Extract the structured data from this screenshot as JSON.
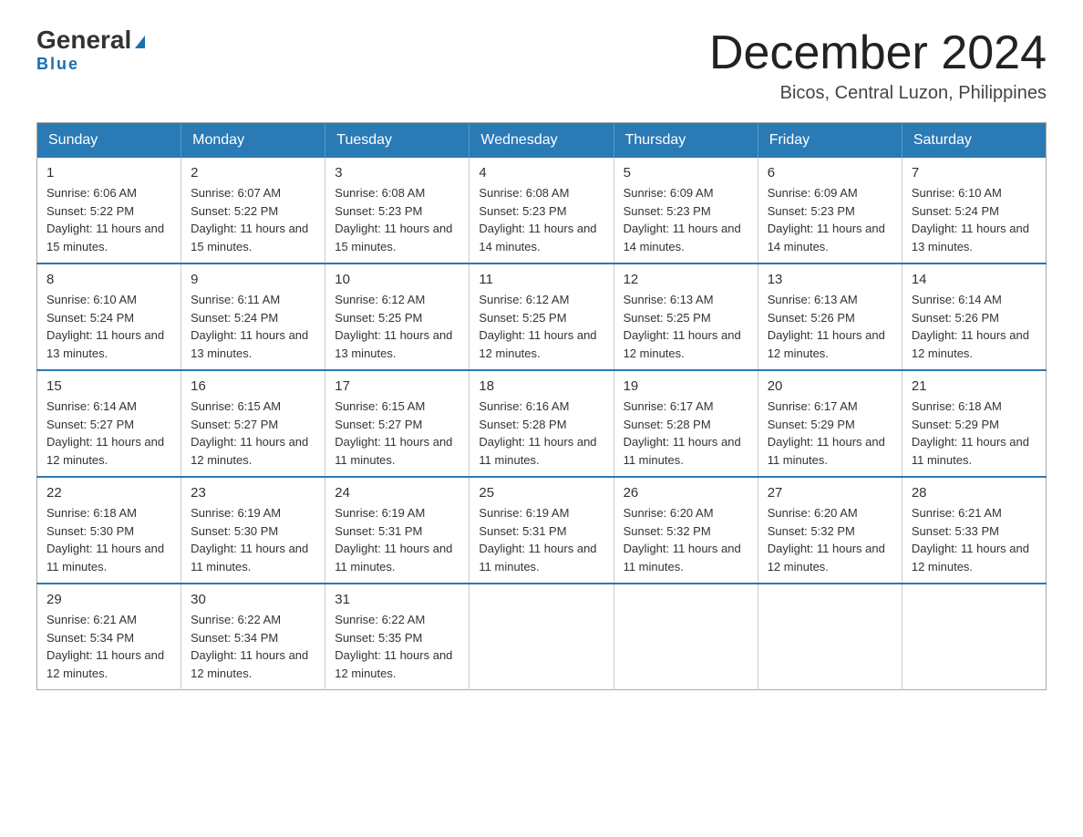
{
  "header": {
    "logo_general": "General",
    "logo_blue": "Blue",
    "month_title": "December 2024",
    "subtitle": "Bicos, Central Luzon, Philippines"
  },
  "days_of_week": [
    "Sunday",
    "Monday",
    "Tuesday",
    "Wednesday",
    "Thursday",
    "Friday",
    "Saturday"
  ],
  "weeks": [
    [
      {
        "day": "1",
        "sunrise": "6:06 AM",
        "sunset": "5:22 PM",
        "daylight": "11 hours and 15 minutes."
      },
      {
        "day": "2",
        "sunrise": "6:07 AM",
        "sunset": "5:22 PM",
        "daylight": "11 hours and 15 minutes."
      },
      {
        "day": "3",
        "sunrise": "6:08 AM",
        "sunset": "5:23 PM",
        "daylight": "11 hours and 15 minutes."
      },
      {
        "day": "4",
        "sunrise": "6:08 AM",
        "sunset": "5:23 PM",
        "daylight": "11 hours and 14 minutes."
      },
      {
        "day": "5",
        "sunrise": "6:09 AM",
        "sunset": "5:23 PM",
        "daylight": "11 hours and 14 minutes."
      },
      {
        "day": "6",
        "sunrise": "6:09 AM",
        "sunset": "5:23 PM",
        "daylight": "11 hours and 14 minutes."
      },
      {
        "day": "7",
        "sunrise": "6:10 AM",
        "sunset": "5:24 PM",
        "daylight": "11 hours and 13 minutes."
      }
    ],
    [
      {
        "day": "8",
        "sunrise": "6:10 AM",
        "sunset": "5:24 PM",
        "daylight": "11 hours and 13 minutes."
      },
      {
        "day": "9",
        "sunrise": "6:11 AM",
        "sunset": "5:24 PM",
        "daylight": "11 hours and 13 minutes."
      },
      {
        "day": "10",
        "sunrise": "6:12 AM",
        "sunset": "5:25 PM",
        "daylight": "11 hours and 13 minutes."
      },
      {
        "day": "11",
        "sunrise": "6:12 AM",
        "sunset": "5:25 PM",
        "daylight": "11 hours and 12 minutes."
      },
      {
        "day": "12",
        "sunrise": "6:13 AM",
        "sunset": "5:25 PM",
        "daylight": "11 hours and 12 minutes."
      },
      {
        "day": "13",
        "sunrise": "6:13 AM",
        "sunset": "5:26 PM",
        "daylight": "11 hours and 12 minutes."
      },
      {
        "day": "14",
        "sunrise": "6:14 AM",
        "sunset": "5:26 PM",
        "daylight": "11 hours and 12 minutes."
      }
    ],
    [
      {
        "day": "15",
        "sunrise": "6:14 AM",
        "sunset": "5:27 PM",
        "daylight": "11 hours and 12 minutes."
      },
      {
        "day": "16",
        "sunrise": "6:15 AM",
        "sunset": "5:27 PM",
        "daylight": "11 hours and 12 minutes."
      },
      {
        "day": "17",
        "sunrise": "6:15 AM",
        "sunset": "5:27 PM",
        "daylight": "11 hours and 11 minutes."
      },
      {
        "day": "18",
        "sunrise": "6:16 AM",
        "sunset": "5:28 PM",
        "daylight": "11 hours and 11 minutes."
      },
      {
        "day": "19",
        "sunrise": "6:17 AM",
        "sunset": "5:28 PM",
        "daylight": "11 hours and 11 minutes."
      },
      {
        "day": "20",
        "sunrise": "6:17 AM",
        "sunset": "5:29 PM",
        "daylight": "11 hours and 11 minutes."
      },
      {
        "day": "21",
        "sunrise": "6:18 AM",
        "sunset": "5:29 PM",
        "daylight": "11 hours and 11 minutes."
      }
    ],
    [
      {
        "day": "22",
        "sunrise": "6:18 AM",
        "sunset": "5:30 PM",
        "daylight": "11 hours and 11 minutes."
      },
      {
        "day": "23",
        "sunrise": "6:19 AM",
        "sunset": "5:30 PM",
        "daylight": "11 hours and 11 minutes."
      },
      {
        "day": "24",
        "sunrise": "6:19 AM",
        "sunset": "5:31 PM",
        "daylight": "11 hours and 11 minutes."
      },
      {
        "day": "25",
        "sunrise": "6:19 AM",
        "sunset": "5:31 PM",
        "daylight": "11 hours and 11 minutes."
      },
      {
        "day": "26",
        "sunrise": "6:20 AM",
        "sunset": "5:32 PM",
        "daylight": "11 hours and 11 minutes."
      },
      {
        "day": "27",
        "sunrise": "6:20 AM",
        "sunset": "5:32 PM",
        "daylight": "11 hours and 12 minutes."
      },
      {
        "day": "28",
        "sunrise": "6:21 AM",
        "sunset": "5:33 PM",
        "daylight": "11 hours and 12 minutes."
      }
    ],
    [
      {
        "day": "29",
        "sunrise": "6:21 AM",
        "sunset": "5:34 PM",
        "daylight": "11 hours and 12 minutes."
      },
      {
        "day": "30",
        "sunrise": "6:22 AM",
        "sunset": "5:34 PM",
        "daylight": "11 hours and 12 minutes."
      },
      {
        "day": "31",
        "sunrise": "6:22 AM",
        "sunset": "5:35 PM",
        "daylight": "11 hours and 12 minutes."
      },
      null,
      null,
      null,
      null
    ]
  ]
}
